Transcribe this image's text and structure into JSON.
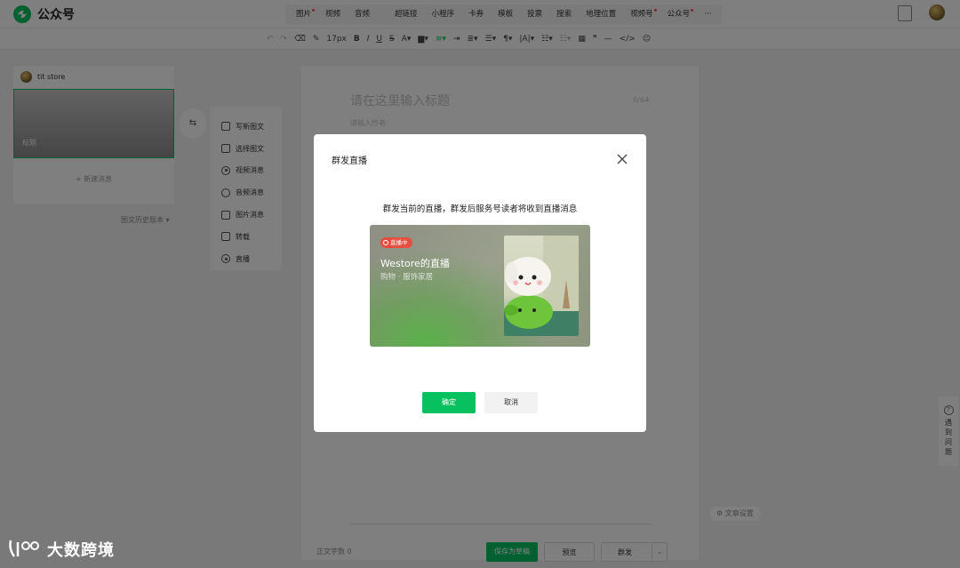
{
  "app": {
    "name": "公众号",
    "brand_color": "#07c160"
  },
  "topbar": {
    "insert_items": [
      {
        "label": "图片",
        "badge": true
      },
      {
        "label": "视频",
        "badge": false
      },
      {
        "label": "音频",
        "badge": false
      },
      {
        "label": "超链接",
        "badge": false
      },
      {
        "label": "小程序",
        "badge": false
      },
      {
        "label": "卡券",
        "badge": false
      },
      {
        "label": "模板",
        "badge": false
      },
      {
        "label": "投票",
        "badge": false
      },
      {
        "label": "搜索",
        "badge": false
      },
      {
        "label": "地理位置",
        "badge": false
      },
      {
        "label": "视频号",
        "badge": true
      },
      {
        "label": "公众号",
        "badge": true
      },
      {
        "label": "···",
        "badge": false
      }
    ]
  },
  "format_toolbar": {
    "font_size": "17px",
    "tools": [
      "undo-icon",
      "redo-icon",
      "eraser-icon",
      "format-painter-icon",
      "bold-icon",
      "italic-icon",
      "underline-icon",
      "strikethrough-icon",
      "font-color-icon",
      "highlight-icon",
      "align-icon",
      "indent-icon",
      "line-height-icon",
      "spacing-icon",
      "list-icon",
      "table-icon",
      "quote-icon",
      "divider-icon",
      "code-icon",
      "emoji-icon"
    ]
  },
  "left_panel": {
    "account_name": "tit store",
    "cover_title": "标题",
    "new_message": "新建消息",
    "history": "图文历史版本"
  },
  "insert_menu": {
    "items": [
      {
        "label": "写新图文",
        "icon": "document-icon"
      },
      {
        "label": "选择图文",
        "icon": "document-select-icon"
      },
      {
        "label": "视频消息",
        "icon": "video-icon"
      },
      {
        "label": "音频消息",
        "icon": "audio-icon"
      },
      {
        "label": "图片消息",
        "icon": "image-icon"
      },
      {
        "label": "转载",
        "icon": "repost-icon"
      },
      {
        "label": "直播",
        "icon": "live-icon"
      }
    ]
  },
  "editor": {
    "title_placeholder": "请在这里输入标题",
    "title_count": "0/64",
    "author_placeholder": "请输入作者"
  },
  "bottom_bar": {
    "word_count": "正文字数 0",
    "save_draft": "保存为草稿",
    "preview": "预览",
    "mass_send": "群发"
  },
  "side": {
    "article_settings": "文章设置",
    "help": "遇到问题"
  },
  "modal": {
    "title": "群发直播",
    "description": "群发当前的直播，群发后服务号读者将收到直播消息",
    "live_card": {
      "badge": "直播中",
      "name": "Westore的直播",
      "category": "购物 · 服饰家居"
    },
    "confirm": "确定",
    "cancel": "取消"
  },
  "watermark": {
    "text": "大数跨境"
  }
}
